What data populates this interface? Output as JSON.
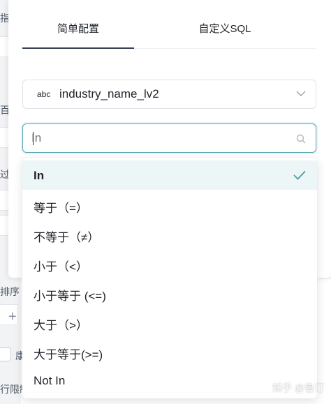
{
  "tabs": [
    {
      "label": "简单配置",
      "active": true
    },
    {
      "label": "自定义SQL",
      "active": false
    }
  ],
  "field": {
    "type_badge": "abc",
    "name": "industry_name_lv2"
  },
  "operator_search": {
    "value": "In",
    "placeholder": "In"
  },
  "operators": [
    {
      "label": "In",
      "selected": true
    },
    {
      "label": "等于（=）",
      "selected": false
    },
    {
      "label": "不等于（≠）",
      "selected": false
    },
    {
      "label": "小于（<）",
      "selected": false
    },
    {
      "label": "小于等于 (<=)",
      "selected": false
    },
    {
      "label": "大于（>）",
      "selected": false
    },
    {
      "label": "大于等于(>=)",
      "selected": false
    },
    {
      "label": "Not In",
      "selected": false
    }
  ],
  "background_fragments": {
    "f1": "指",
    "f2": "百",
    "f3": "过",
    "f4": "排序",
    "plus": "+",
    "f5": "康",
    "f6": "行限制"
  },
  "watermark": "知乎 @鲁汀",
  "colors": {
    "tab_underline": "#354054",
    "focus_border": "#5aa8b4",
    "selected_bg": "#edf6f7",
    "check": "#4a9aa6"
  }
}
